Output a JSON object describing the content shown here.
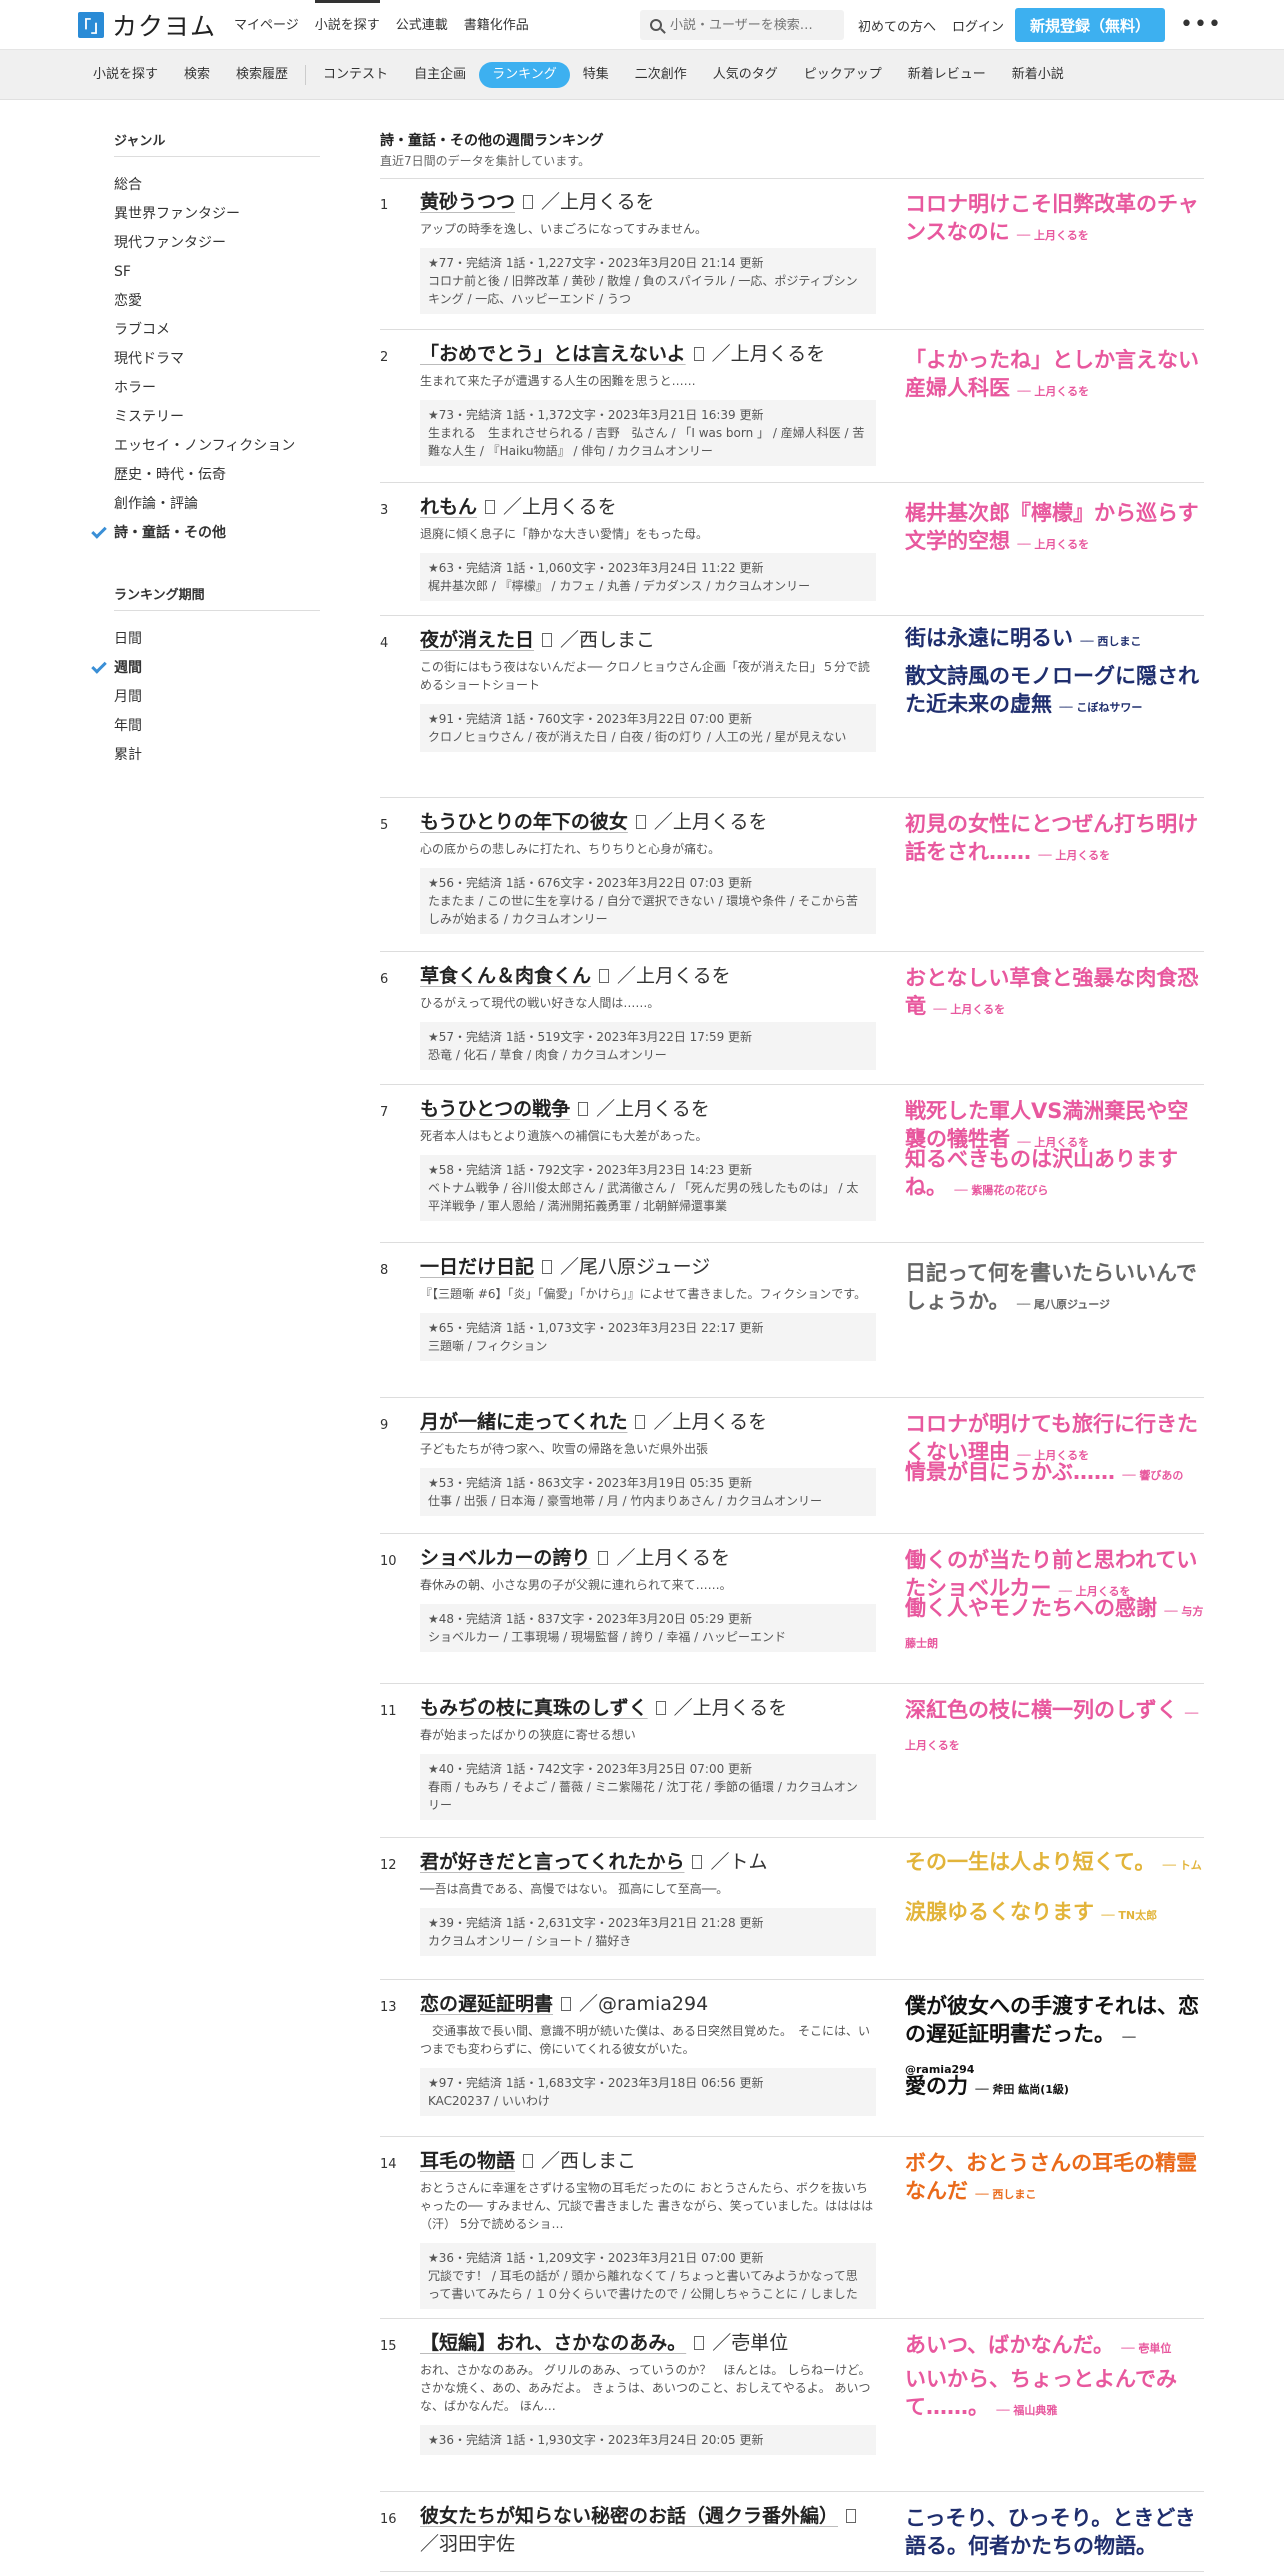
{
  "header": {
    "logo_mark": "「」",
    "logo_text": "カクヨム",
    "nav": [
      "マイページ",
      "小説を探す",
      "公式連載",
      "書籍化作品"
    ],
    "search_placeholder": "小説・ユーザーを検索…",
    "first_time": "初めての方へ",
    "login": "ログイン",
    "signup": "新規登録（無料）"
  },
  "subnav": {
    "group1": [
      "小説を探す",
      "検索",
      "検索履歴"
    ],
    "group2": [
      "コンテスト",
      "自主企画",
      "ランキング",
      "特集",
      "二次創作",
      "人気のタグ",
      "ピックアップ",
      "新着レビュー",
      "新着小説"
    ]
  },
  "sidebar": {
    "genre_head": "ジャンル",
    "genres": [
      "総合",
      "異世界ファンタジー",
      "現代ファンタジー",
      "SF",
      "恋愛",
      "ラブコメ",
      "現代ドラマ",
      "ホラー",
      "ミステリー",
      "エッセイ・ノンフィクション",
      "歴史・時代・伝奇",
      "創作論・評論",
      "詩・童話・その他"
    ],
    "period_head": "ランキング期間",
    "periods": [
      "日間",
      "週間",
      "月間",
      "年間",
      "累計"
    ]
  },
  "main": {
    "title": "詩・童話・その他の週間ランキング",
    "subtitle": "直近7日間のデータを集計しています。"
  },
  "colors": {
    "pink": "#e8589e",
    "navy": "#1f2e6e",
    "gray": "#666666",
    "yellow": "#e2b43a",
    "black": "#111111",
    "orange": "#ea6a1a",
    "link": "#3db0f0"
  },
  "entries": [
    {
      "rank": "1",
      "title": "黄砂うつつ",
      "author": "／上月くるを",
      "desc": "アップの時季を逸し、いまごろになってすみません。",
      "meta": "★77・完結済 1話・1,227文字・2023年3月20日 21:14 更新\nコロナ前と後 / 旧弊改革 / 黄砂 / 散煌 / 負のスパイラル / 一応、ポジティブシンキング / 一応、ハッピーエンド / うつ",
      "catches": [
        {
          "text": "コロナ明けこそ旧弊改革のチャンスなのに",
          "by": "── 上月くるを",
          "color": "pink"
        }
      ]
    },
    {
      "rank": "2",
      "title": "「おめでとう」とは言えないよ",
      "author": "／上月くるを",
      "desc": "生まれて来た子が遭遇する人生の困難を思うと……",
      "meta": "★73・完結済 1話・1,372文字・2023年3月21日 16:39 更新\n生まれる　生まれさせられる / 吉野　弘さん / 「I was born 」 / 産婦人科医 / 苦難な人生 / 『Haiku物語』 / 俳句 / カクヨムオンリー",
      "catches": [
        {
          "text": "「よかったね」としか言えない産婦人科医",
          "by": "── 上月くるを",
          "color": "pink"
        }
      ]
    },
    {
      "rank": "3",
      "title": "れもん",
      "author": "／上月くるを",
      "desc": "退廃に傾く息子に「静かな大きい愛情」をもった母。",
      "meta": "★63・完結済 1話・1,060文字・2023年3月24日 11:22 更新\n梶井基次郎 / 『檸檬』 / カフェ / 丸善 / デカダンス / カクヨムオンリー",
      "catches": [
        {
          "text": "梶井基次郎『檸檬』から巡らす文学的空想",
          "by": "── 上月くるを",
          "color": "pink"
        }
      ]
    },
    {
      "rank": "4",
      "title": "夜が消えた日",
      "author": "／西しまこ",
      "desc": "この街にはもう夜はないんだよ── クロノヒョウさん企画「夜が消えた日」５分で読めるショートショート",
      "meta": "★91・完結済 1話・760文字・2023年3月22日 07:00 更新\nクロノヒョウさん / 夜が消えた日 / 白夜 / 街の灯り / 人工の光 / 星が見えない",
      "catches": [
        {
          "text": "街は永遠に明るい",
          "by": "── 西しまこ",
          "color": "navy"
        },
        {
          "text": "散文詩風のモノローグに隠された近未来の虚無",
          "by": "── こぼねサワー",
          "color": "navy"
        }
      ]
    },
    {
      "rank": "5",
      "title": "もうひとりの年下の彼女",
      "author": "／上月くるを",
      "desc": "心の底からの悲しみに打たれ、ちりちりと心身が痛む。",
      "meta": "★56・完結済 1話・676文字・2023年3月22日 07:03 更新\nたまたま / この世に生を享ける / 自分で選択できない / 環境や条件 / そこから苦しみが始まる / カクヨムオンリー",
      "catches": [
        {
          "text": "初見の女性にとつぜん打ち明け話をされ……",
          "by": "── 上月くるを",
          "color": "pink"
        }
      ]
    },
    {
      "rank": "6",
      "title": "草食くん＆肉食くん",
      "author": "／上月くるを",
      "desc": "ひるがえって現代の戦い好きな人間は……。",
      "meta": "★57・完結済 1話・519文字・2023年3月22日 17:59 更新\n恐竜 / 化石 / 草食 / 肉食 / カクヨムオンリー",
      "catches": [
        {
          "text": "おとなしい草食と強暴な肉食恐竜",
          "by": "── 上月くるを",
          "color": "pink"
        }
      ]
    },
    {
      "rank": "7",
      "title": "もうひとつの戦争",
      "author": "／上月くるを",
      "desc": "死者本人はもとより遺族への補償にも大差があった。",
      "meta": "★58・完結済 1話・792文字・2023年3月23日 14:23 更新\nベトナム戦争 / 谷川俊太郎さん / 武満徹さん / 「死んだ男の残したものは」 / 太平洋戦争 / 軍人恩給 / 満洲開拓義勇軍 / 北朝鮮帰還事業",
      "catches": [
        {
          "text": "戦死した軍人VS満洲棄民や空襲の犠牲者",
          "by": "── 上月くるを",
          "color": "pink"
        },
        {
          "text": "知るべきものは沢山ありますね。",
          "by": "── 紫陽花の花びら",
          "color": "pink"
        }
      ]
    },
    {
      "rank": "8",
      "title": "一日だけ日記",
      "author": "／尾八原ジュージ",
      "desc": "『【三題噺 #6】「炎」「偏愛」「かけら」』によせて書きました。フィクションです。",
      "meta": "★65・完結済 1話・1,073文字・2023年3月23日 22:17 更新\n三題噺 / フィクション",
      "catches": [
        {
          "text": "日記って何を書いたらいいんでしょうか。",
          "by": "── 尾八原ジュージ",
          "color": "gray"
        }
      ]
    },
    {
      "rank": "9",
      "title": "月が一緒に走ってくれた",
      "author": "／上月くるを",
      "desc": "子どもたちが待つ家へ、吹雪の帰路を急いだ県外出張",
      "meta": "★53・完結済 1話・863文字・2023年3月19日 05:35 更新\n仕事 / 出張 / 日本海 / 豪雪地帯 / 月 / 竹内まりあさん / カクヨムオンリー",
      "catches": [
        {
          "text": "コロナが明けても旅行に行きたくない理由",
          "by": "── 上月くるを",
          "color": "pink"
        },
        {
          "text": "情景が目にうかぶ……",
          "by": "── 響びあの",
          "color": "pink"
        }
      ]
    },
    {
      "rank": "10",
      "title": "ショベルカーの誇り",
      "author": "／上月くるを",
      "desc": "春休みの朝、小さな男の子が父親に連れられて来て……。",
      "meta": "★48・完結済 1話・837文字・2023年3月20日 05:29 更新\nショベルカー / 工事現場 / 現場監督 / 誇り / 幸福 / ハッピーエンド",
      "catches": [
        {
          "text": "働くのが当たり前と思われていたショベルカー",
          "by": "── 上月くるを",
          "color": "pink"
        },
        {
          "text": "働く人やモノたちへの感謝",
          "by": "── 与方藤士朗",
          "color": "pink"
        }
      ]
    },
    {
      "rank": "11",
      "title": "もみぢの枝に真珠のしずく",
      "author": "／上月くるを",
      "desc": "春が始まったばかりの狭庭に寄せる想い",
      "meta": "★40・完結済 1話・742文字・2023年3月25日 07:00 更新\n春雨 / もみち / そよご / 薔薇 / ミニ紫陽花 / 沈丁花 / 季節の循環 / カクヨムオンリー",
      "catches": [
        {
          "text": "深紅色の枝に横一列のしずく",
          "by": "── 上月くるを",
          "color": "pink"
        }
      ]
    },
    {
      "rank": "12",
      "title": "君が好きだと言ってくれたから",
      "author": "／トム",
      "desc": "──吾は高貴である、高慢ではない。 孤高にして至高──。",
      "meta": "★39・完結済 1話・2,631文字・2023年3月21日 21:28 更新\nカクヨムオンリー / ショート / 猫好き",
      "catches": [
        {
          "text": "その一生は人より短くて。",
          "by": "── トム",
          "color": "yellow"
        },
        {
          "text": "涙腺ゆるくなります",
          "by": "── TN太郎",
          "color": "yellow"
        }
      ]
    },
    {
      "rank": "13",
      "title": "恋の遅延証明書",
      "author": "／@ramia294",
      "desc": "　交通事故で長い間、意識不明が続いた僕は、ある日突然目覚めた。　そこには、いつまでも変わらずに、傍にいてくれる彼女がいた。",
      "meta": "★97・完結済 1話・1,683文字・2023年3月18日 06:56 更新\nKAC20237 / いいわけ",
      "catches": [
        {
          "text": "僕が彼女への手渡すそれは、恋の遅延証明書だった。",
          "by": "── @ramia294",
          "color": "black"
        },
        {
          "text": "愛の力",
          "by": "── 斧田 紘尚(1級)",
          "color": "black"
        }
      ]
    },
    {
      "rank": "14",
      "title": "耳毛の物語",
      "author": "／西しまこ",
      "desc": "おとうさんに幸運をさずける宝物の耳毛だったのに おとうさんたら、ボクを抜いちゃったの── すみません、冗談で書きました 書きながら、笑っていました。はははは（汗） 5分で読めるショ…",
      "meta": "★36・完結済 1話・1,209文字・2023年3月21日 07:00 更新\n冗談です！ / 耳毛の話が / 頭から離れなくて / ちょっと書いてみようかなって思って書いてみたら / １０分くらいで書けたので / 公開しちゃうことに / しました",
      "catches": [
        {
          "text": "ボク、おとうさんの耳毛の精霊なんだ",
          "by": "── 西しまこ",
          "color": "orange"
        }
      ]
    },
    {
      "rank": "15",
      "title": "【短編】おれ、さかなのあみ。",
      "author": "／壱単位",
      "desc": "おれ、さかなのあみ。 グリルのあみ、っていうのか？　ほんとは。 しらねーけど。さかな焼く、あの、あみだよ。 きょうは、あいつのこと、おしえてやるよ。 あいつな、ばかなんだ。 ほん…",
      "meta": "★36・完結済 1話・1,930文字・2023年3月24日 20:05 更新",
      "catches": [
        {
          "text": "あいつ、ばかなんだ。",
          "by": "── 壱単位",
          "color": "pink"
        },
        {
          "text": "いいから、ちょっとよんでみて……。",
          "by": "── 福山典雅",
          "color": "pink"
        }
      ]
    },
    {
      "rank": "16",
      "title": "彼女たちが知らない秘密のお話（週クラ番外編）",
      "author": "／羽田宇佐",
      "desc": "",
      "meta": "",
      "catches": [
        {
          "text": "こっそり、ひっそり。ときどき語る。何者かたちの物語。",
          "by": "",
          "color": "navy"
        }
      ]
    }
  ]
}
